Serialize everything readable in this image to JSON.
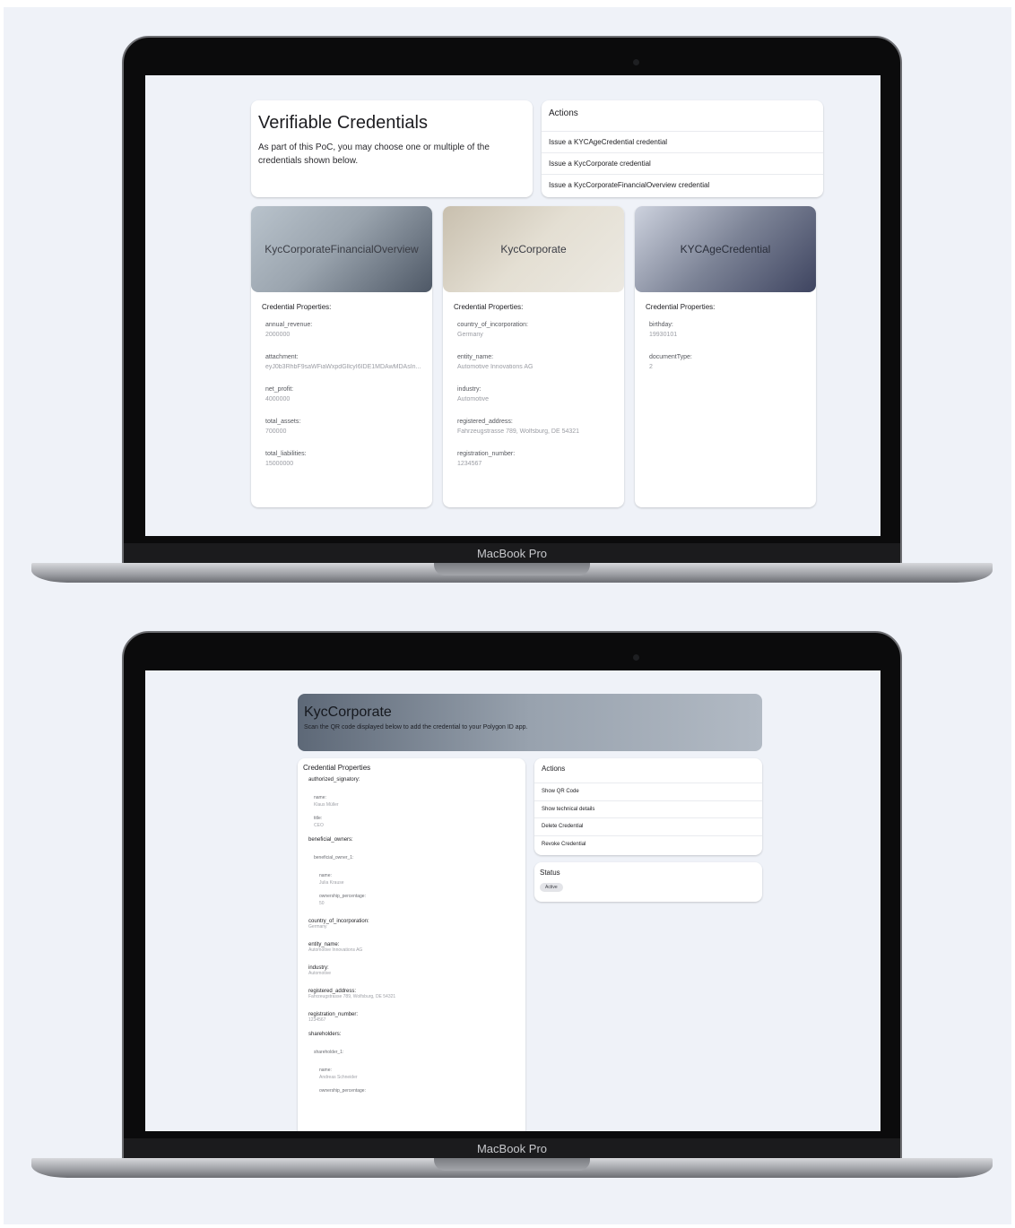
{
  "device_label": "MacBook Pro",
  "overview": {
    "title": "Verifiable Credentials",
    "description": "As part of this PoC, you may choose one or multiple of the credentials shown below.",
    "actions": {
      "title": "Actions",
      "items": [
        "Issue a KYCAgeCredential credential",
        "Issue a KycCorporate credential",
        "Issue a KycCorporateFinancialOverview credential"
      ]
    },
    "cards": [
      {
        "name": "KycCorporateFinancialOverview",
        "props_title": "Credential Properties:",
        "props": [
          {
            "key": "annual_revenue:",
            "value": "2000000"
          },
          {
            "key": "attachment:",
            "value": "eyJ0b3RhbF9saWFiaWxpdGllcyI6IDE1MDAwMDAsIn..."
          },
          {
            "key": "net_profit:",
            "value": "4000000"
          },
          {
            "key": "total_assets:",
            "value": "700000"
          },
          {
            "key": "total_liabilities:",
            "value": "15000000"
          }
        ]
      },
      {
        "name": "KycCorporate",
        "props_title": "Credential Properties:",
        "props": [
          {
            "key": "country_of_incorporation:",
            "value": "Germany"
          },
          {
            "key": "entity_name:",
            "value": "Automotive Innovations AG"
          },
          {
            "key": "industry:",
            "value": "Automotive"
          },
          {
            "key": "registered_address:",
            "value": "Fahrzeugstrasse 789, Wolfsburg, DE 54321"
          },
          {
            "key": "registration_number:",
            "value": "1234567"
          }
        ]
      },
      {
        "name": "KYCAgeCredential",
        "props_title": "Credential Properties:",
        "props": [
          {
            "key": "birthday:",
            "value": "19930101"
          },
          {
            "key": "documentType:",
            "value": "2"
          }
        ]
      }
    ]
  },
  "detail": {
    "title": "KycCorporate",
    "subtitle": "Scan the QR code displayed below to add the credential to your Polygon ID app.",
    "props_title": "Credential Properties",
    "authorized_signatory": {
      "key": "authorized_signatory:",
      "name_key": "name:",
      "name_val": "Klaus Müller",
      "title_key": "title:",
      "title_val": "CEO"
    },
    "beneficial_owners": {
      "key": "beneficial_owners:",
      "owner_key": "beneficial_owner_1:",
      "name_key": "name:",
      "name_val": "Julia Krause",
      "pct_key": "ownership_percentage:",
      "pct_val": "50"
    },
    "fields": [
      {
        "key": "country_of_incorporation:",
        "value": "Germany"
      },
      {
        "key": "entity_name:",
        "value": "Automotive Innovations AG"
      },
      {
        "key": "industry:",
        "value": "Automotive"
      },
      {
        "key": "registered_address:",
        "value": "Fahrzeugstrasse 789, Wolfsburg, DE 54321"
      },
      {
        "key": "registration_number:",
        "value": "1234567"
      }
    ],
    "shareholders": {
      "key": "shareholders:",
      "holder_key": "shareholder_1:",
      "name_key": "name:",
      "name_val": "Andreas Schneider",
      "pct_key": "ownership_percentage:"
    },
    "actions": {
      "title": "Actions",
      "items": [
        "Show QR Code",
        "Show technical details",
        "Delete Credential",
        "Revoke Credential"
      ]
    },
    "status": {
      "title": "Status",
      "badge": "Active"
    }
  }
}
